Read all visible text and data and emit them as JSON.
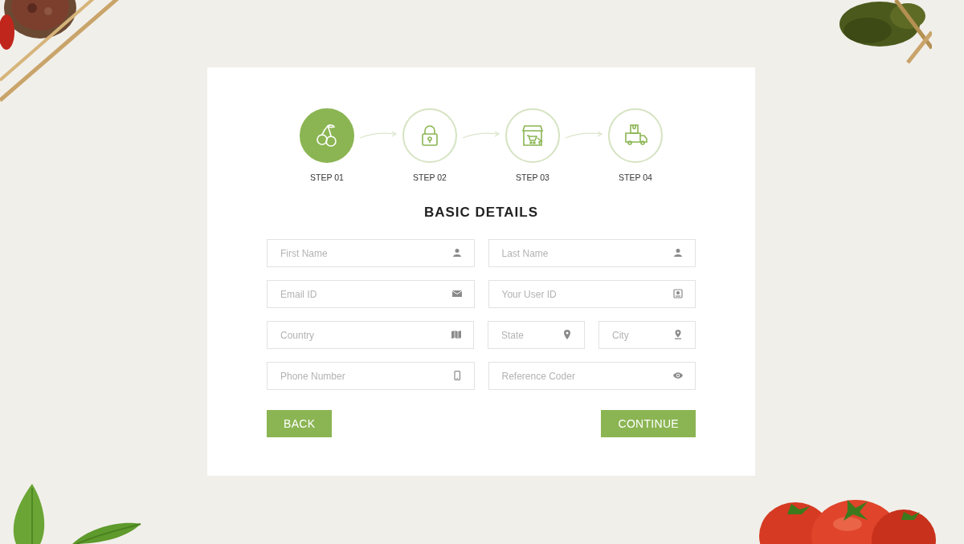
{
  "steps": [
    {
      "label": "STEP 01",
      "selected": true,
      "kind": "cherry"
    },
    {
      "label": "STEP 02",
      "selected": false,
      "kind": "lock"
    },
    {
      "label": "STEP 03",
      "selected": false,
      "kind": "store"
    },
    {
      "label": "STEP 04",
      "selected": false,
      "kind": "truck"
    }
  ],
  "title": "BASIC DETAILS",
  "rows": [
    [
      {
        "placeholder": "First Name",
        "kind": "person"
      },
      {
        "placeholder": "Last Name",
        "kind": "person"
      }
    ],
    [
      {
        "placeholder": "Email ID",
        "kind": "mail"
      },
      {
        "placeholder": "Your User ID",
        "kind": "badge"
      }
    ],
    [
      {
        "placeholder": "Country",
        "kind": "map"
      },
      {
        "placeholder": "State",
        "kind": "pin"
      },
      {
        "placeholder": "City",
        "kind": "pin-base"
      }
    ],
    [
      {
        "placeholder": "Phone Number",
        "kind": "phone"
      },
      {
        "placeholder": "Reference Coder",
        "kind": "eye"
      }
    ]
  ],
  "buttons": {
    "back": "BACK",
    "continue": "CONTINUE"
  }
}
